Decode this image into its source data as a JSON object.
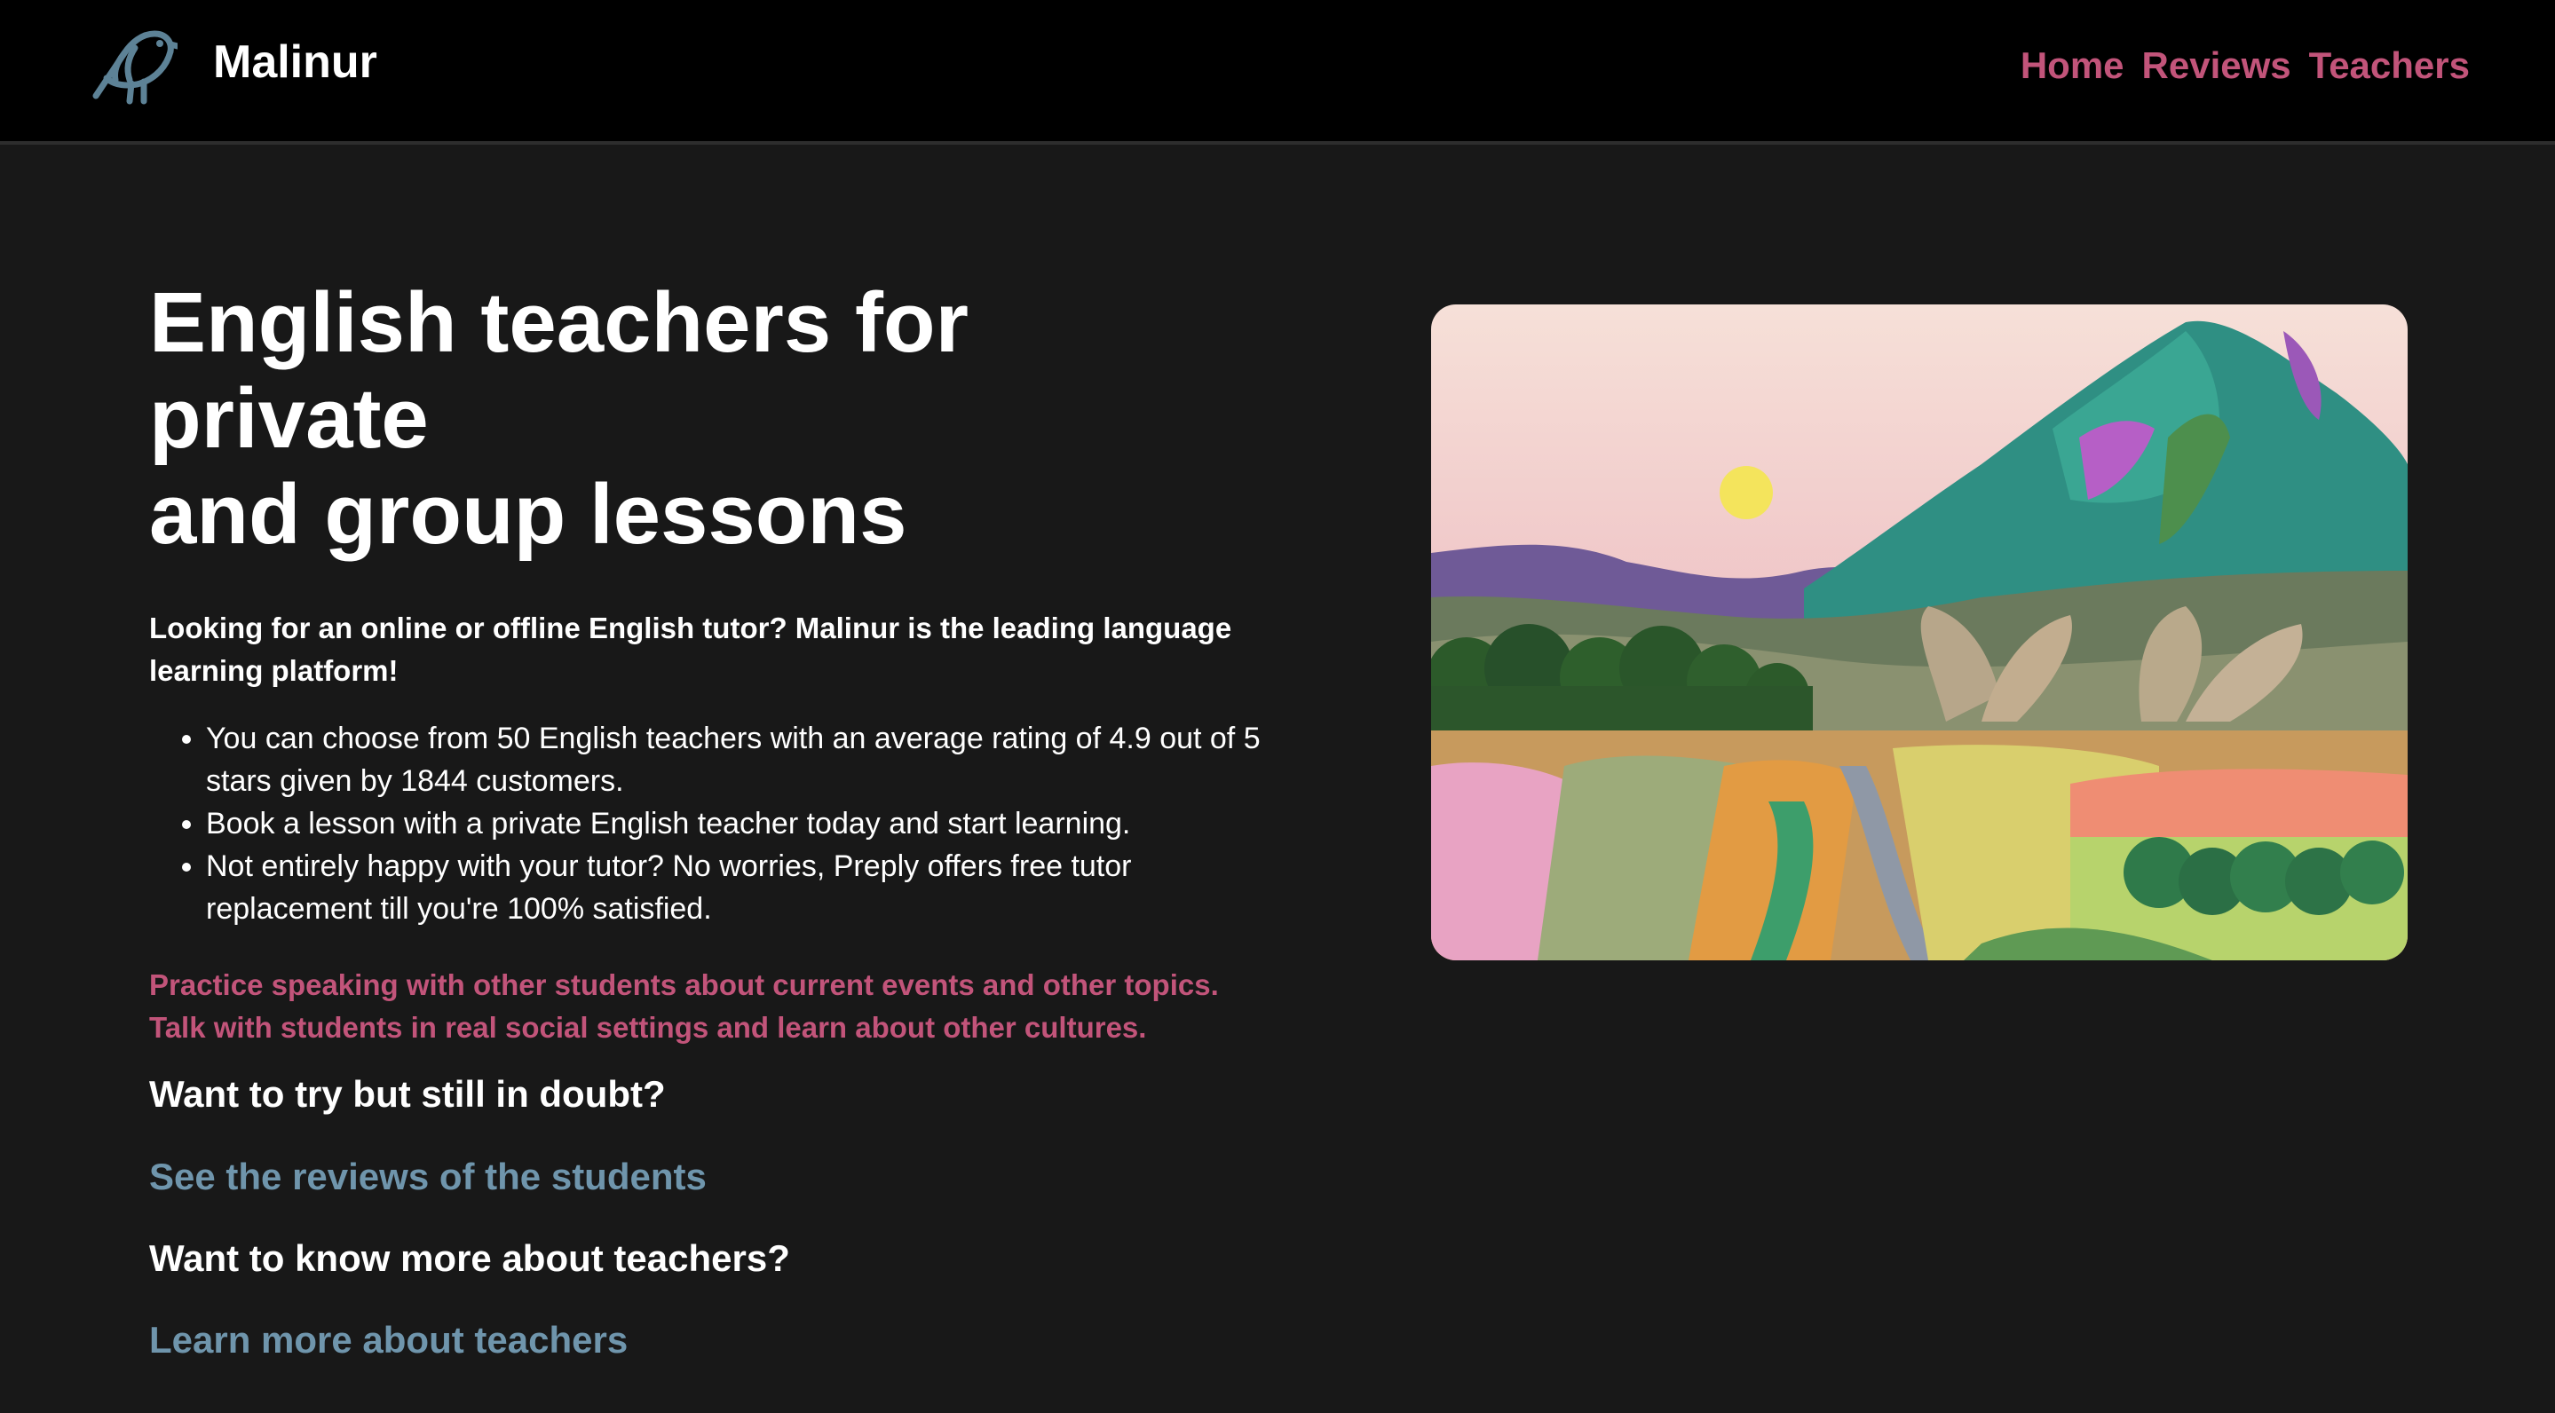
{
  "header": {
    "brand": "Malinur",
    "nav": [
      "Home",
      "Reviews",
      "Teachers"
    ]
  },
  "hero": {
    "title_line1": "English teachers for private",
    "title_line2": "and group lessons",
    "lead": "Looking for an online or offline English tutor? Malinur is the leading language learning platform!",
    "bullets": [
      "You can choose from 50 English teachers with an average rating of 4.9 out of 5 stars given by 1844 customers.",
      "Book a lesson with a private English teacher today and start learning.",
      "Not entirely happy with your tutor? No worries, Preply offers free tutor replacement till you're 100% satisfied."
    ],
    "pink_text": "Practice speaking with other students about current events and other topics. Talk with students in real social settings and learn about other cultures."
  },
  "cta": {
    "reviews_question": "Want to try but still in doubt?",
    "reviews_link": "See the reviews of the students",
    "teachers_question": "Want to know more about teachers?",
    "teachers_link": "Learn more about teachers"
  },
  "colors": {
    "accent_pink": "#c2547a",
    "link_blue": "#6f95ac",
    "background": "#181818",
    "header_bg": "#000000"
  },
  "icons": {
    "logo": "bird-icon"
  }
}
